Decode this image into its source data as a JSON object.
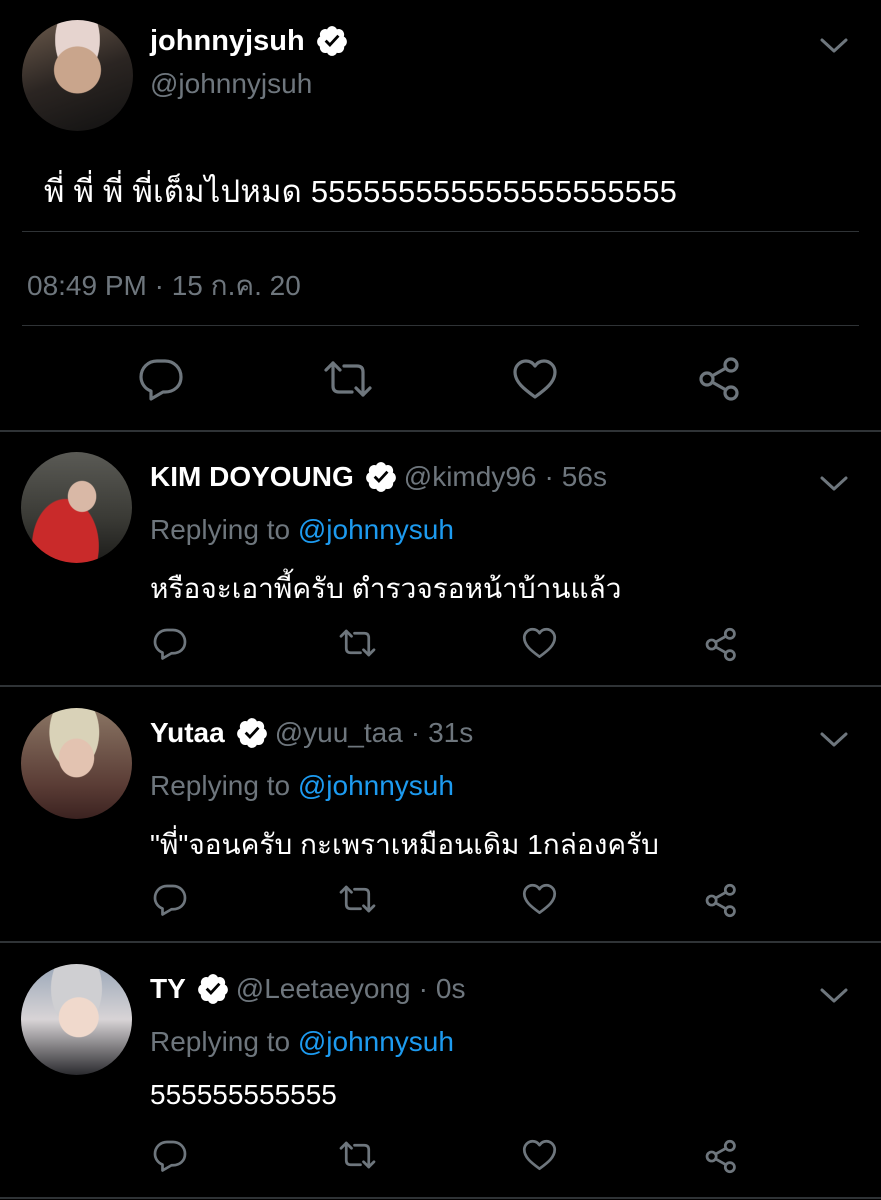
{
  "main_tweet": {
    "display_name": "johnnyjsuh",
    "handle": "@johnnyjsuh",
    "text": "พี่ พี่ พี่ พี่เต็มไปหมด 555555555555555555555",
    "timestamp": "08:49 PM · 15 ก.ค. 20",
    "verified": true
  },
  "replies": [
    {
      "display_name": "KIM DOYOUNG",
      "handle": "@kimdy96",
      "dot": "·",
      "time": "56s",
      "replying_prefix": "Replying to",
      "replying_to": "@johnnysuh",
      "text": "หรือจะเอาพี้ครับ ตำรวจรอหน้าบ้านแล้ว"
    },
    {
      "display_name": "Yutaa",
      "handle": "@yuu_taa",
      "dot": "·",
      "time": "31s",
      "replying_prefix": "Replying to",
      "replying_to": "@johnnysuh",
      "text": "\"พี่\"จอนครับ กะเพราเหมือนเดิม 1กล่องครับ"
    },
    {
      "display_name": "TY",
      "handle": "@Leetaeyong",
      "dot": "·",
      "time": "0s",
      "replying_prefix": "Replying to",
      "replying_to": "@johnnysuh",
      "text": "555555555555"
    }
  ],
  "colors": {
    "background": "#000000",
    "text": "#ffffff",
    "secondary_text": "#6e767d",
    "link": "#1d9bf0",
    "divider": "#2f3336"
  },
  "icons": [
    "verified-badge-icon",
    "chevron-down-icon",
    "reply-icon",
    "retweet-icon",
    "like-icon",
    "share-icon"
  ]
}
